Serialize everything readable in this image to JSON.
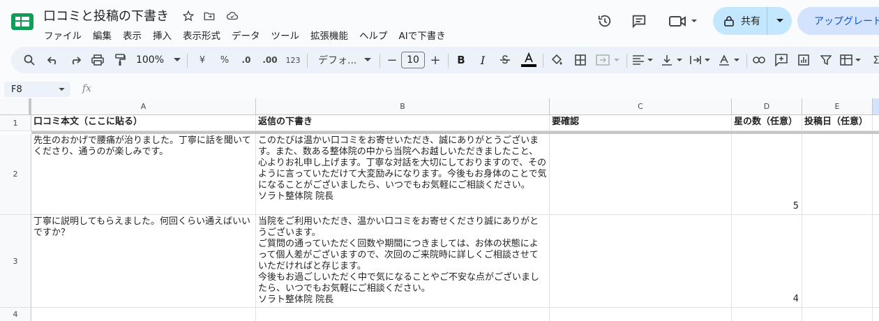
{
  "doc": {
    "title": "口コミと投稿の下書き"
  },
  "menu": [
    "ファイル",
    "編集",
    "表示",
    "挿入",
    "表示形式",
    "データ",
    "ツール",
    "拡張機能",
    "ヘルプ",
    "AIで下書き"
  ],
  "header": {
    "share_label": "共有",
    "upgrade_label": "アップグレード"
  },
  "toolbar": {
    "zoom": "100%",
    "currency": "¥",
    "percent": "%",
    "decimal_decrease": ".0",
    "decimal_increase": ".00",
    "number_format": "123",
    "font": "デフォ...",
    "font_size": "10"
  },
  "formula_bar": {
    "cell_ref": "F8",
    "fx": "fx"
  },
  "grid": {
    "columns": [
      "A",
      "B",
      "C",
      "D",
      "E"
    ],
    "rows": [
      "1",
      "2",
      "3",
      "4"
    ],
    "header_row": [
      "口コミ本文（ここに貼る）",
      "返信の下書き",
      "要確認",
      "星の数（任意）",
      "投稿日（任意）"
    ],
    "data": [
      {
        "review": "先生のおかげで腰痛が治りました。丁寧に話を聞いてくださり、通うのが楽しみです。",
        "reply": "このたびは温かい口コミをお寄せいただき、誠にありがとうございます。また、数ある整体院の中から当院へお越しいただきましたこと、心よりお礼申し上げます。丁寧な対話を大切にしておりますので、そのように言っていただけて大変励みになります。今後もお身体のことで気になることがございましたら、いつでもお気軽にご相談ください。\nソラト整体院 院長",
        "check": "",
        "stars": "5",
        "date": ""
      },
      {
        "review": "丁寧に説明してもらえました。何回くらい通えばいいですか？",
        "reply": "当院をご利用いただき、温かい口コミをお寄せくださり誠にありがとうございます。\nご質問の通っていただく回数や期間につきましては、お体の状態によって個人差がございますので、次回のご来院時に詳しくご相談させていただければと存じます。\n今後もお過ごしいただく中で気になることやご不安な点がございましたら、いつでもお気軽にご相談ください。\nソラト整体院 院長",
        "check": "",
        "stars": "4",
        "date": ""
      }
    ]
  }
}
